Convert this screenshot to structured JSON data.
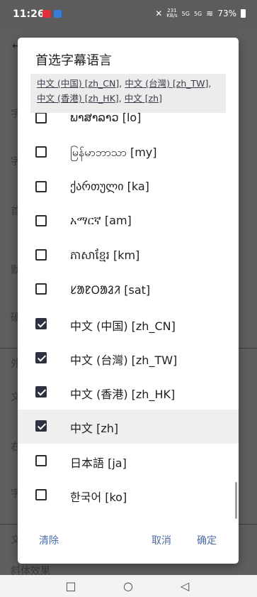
{
  "status": {
    "time": "11:26",
    "speed_value": "231",
    "speed_unit": "KB/s",
    "network_1": "5G",
    "network_2": "5G",
    "battery": "73%"
  },
  "background": {
    "items": [
      "字",
      "字",
      "首",
      "默",
      "硬",
      "外",
      "文",
      "右",
      "字",
      "文",
      "斜体效果"
    ]
  },
  "dialog": {
    "title": "首选字幕语言",
    "summary_items": [
      "中文 (中国) [zh_CN]",
      "中文 (台灣) [zh_TW]",
      "中文 (香港) [zh_HK]",
      "中文 [zh]"
    ],
    "languages": [
      {
        "label": "ພາສາລາວ [lo]",
        "checked": false
      },
      {
        "label": "မြန်မာဘာသာ [my]",
        "checked": false
      },
      {
        "label": "ქართული [ka]",
        "checked": false
      },
      {
        "label": "አማርኛ [am]",
        "checked": false
      },
      {
        "label": "ភាសាខ្មែរ [km]",
        "checked": false
      },
      {
        "label": "ᱥᱟᱱᱛᱟᱲᱤ [sat]",
        "checked": false
      },
      {
        "label": "中文 (中国) [zh_CN]",
        "checked": true
      },
      {
        "label": "中文 (台灣) [zh_TW]",
        "checked": true
      },
      {
        "label": "中文 (香港) [zh_HK]",
        "checked": true
      },
      {
        "label": "中文 [zh]",
        "checked": true
      },
      {
        "label": "日本語 [ja]",
        "checked": false
      },
      {
        "label": "한국어 [ko]",
        "checked": false
      }
    ],
    "buttons": {
      "clear": "清除",
      "cancel": "取消",
      "confirm": "确定"
    }
  },
  "colors": {
    "accent": "#4b6ea5",
    "checkbox_checked": "#2f3040"
  }
}
